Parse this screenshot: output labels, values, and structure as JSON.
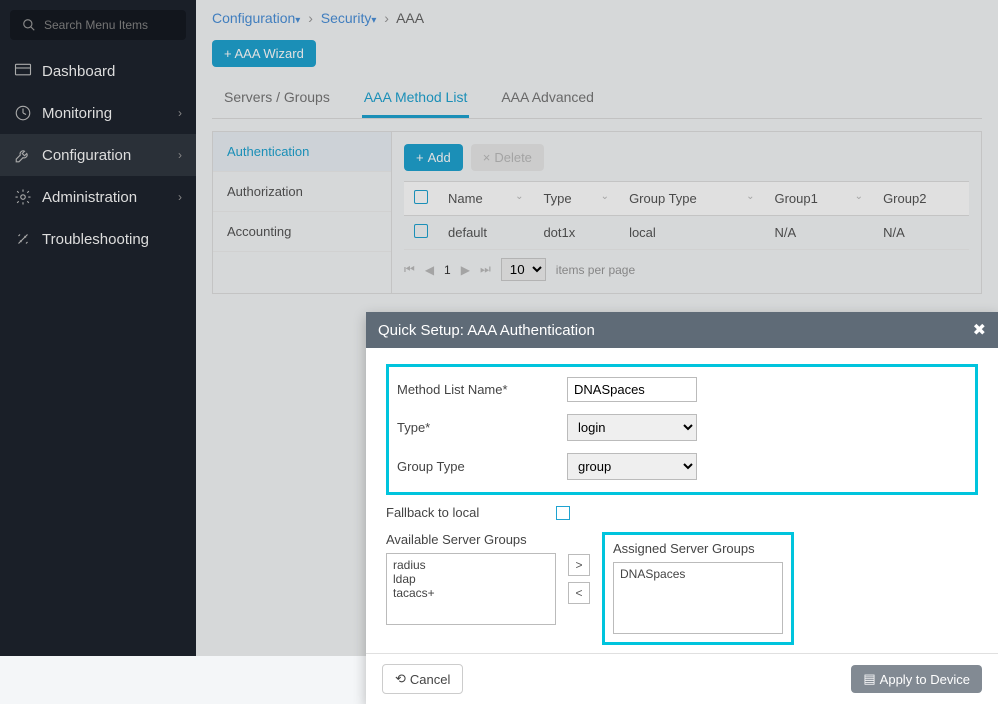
{
  "sidebar": {
    "search_placeholder": "Search Menu Items",
    "items": [
      {
        "label": "Dashboard"
      },
      {
        "label": "Monitoring"
      },
      {
        "label": "Configuration"
      },
      {
        "label": "Administration"
      },
      {
        "label": "Troubleshooting"
      }
    ]
  },
  "breadcrumb": {
    "a": "Configuration",
    "b": "Security",
    "c": "AAA"
  },
  "wizard_btn": "+ AAA Wizard",
  "tabs": {
    "t1": "Servers / Groups",
    "t2": "AAA Method List",
    "t3": "AAA Advanced"
  },
  "subnav": {
    "s1": "Authentication",
    "s2": "Authorization",
    "s3": "Accounting"
  },
  "toolbar": {
    "add": "Add",
    "delete": "Delete"
  },
  "table": {
    "headers": {
      "name": "Name",
      "type": "Type",
      "group_type": "Group Type",
      "group1": "Group1",
      "group2": "Group2"
    },
    "row": {
      "name": "default",
      "type": "dot1x",
      "group_type": "local",
      "group1": "N/A",
      "group2": "N/A"
    },
    "page": "1",
    "page_size": "10",
    "per_page_label": "items per page"
  },
  "modal": {
    "title": "Quick Setup: AAA Authentication",
    "fields": {
      "name_label": "Method List Name*",
      "name_value": "DNASpaces",
      "type_label": "Type*",
      "type_value": "login",
      "group_type_label": "Group Type",
      "group_type_value": "group",
      "fallback_label": "Fallback to local",
      "available_label": "Available Server Groups",
      "assigned_label": "Assigned Server Groups",
      "avail_items": {
        "a": "radius",
        "b": "ldap",
        "c": "tacacs+"
      },
      "assigned_item": "DNASpaces"
    },
    "cancel": "Cancel",
    "apply": "Apply to Device"
  }
}
